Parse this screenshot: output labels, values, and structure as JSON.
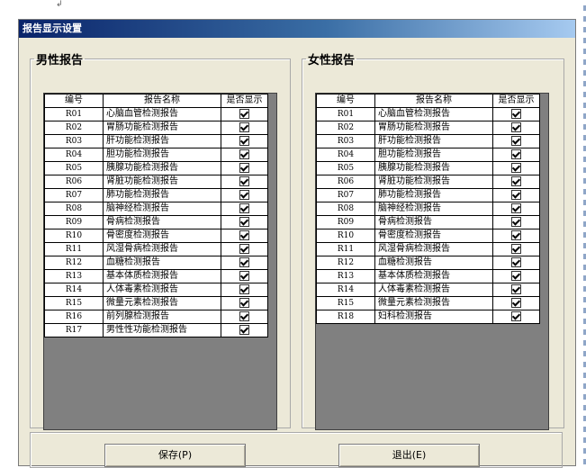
{
  "mark": "↲",
  "window": {
    "title": "报告显示设置"
  },
  "male": {
    "legend": "男性报告",
    "headers": {
      "id": "编号",
      "name": "报告名称",
      "show": "是否显示"
    },
    "rows": [
      {
        "id": "R01",
        "name": "心脑血管检测报告",
        "show": true
      },
      {
        "id": "R02",
        "name": "胃肠功能检测报告",
        "show": true
      },
      {
        "id": "R03",
        "name": "肝功能检测报告",
        "show": true
      },
      {
        "id": "R04",
        "name": "胆功能检测报告",
        "show": true
      },
      {
        "id": "R05",
        "name": "胰腺功能检测报告",
        "show": true
      },
      {
        "id": "R06",
        "name": "肾脏功能检测报告",
        "show": true
      },
      {
        "id": "R07",
        "name": "肺功能检测报告",
        "show": true
      },
      {
        "id": "R08",
        "name": "脑神经检测报告",
        "show": true
      },
      {
        "id": "R09",
        "name": "骨病检测报告",
        "show": true
      },
      {
        "id": "R10",
        "name": "骨密度检测报告",
        "show": true
      },
      {
        "id": "R11",
        "name": "风湿骨病检测报告",
        "show": true
      },
      {
        "id": "R12",
        "name": "血糖检测报告",
        "show": true
      },
      {
        "id": "R13",
        "name": "基本体质检测报告",
        "show": true
      },
      {
        "id": "R14",
        "name": "人体毒素检测报告",
        "show": true
      },
      {
        "id": "R15",
        "name": "微量元素检测报告",
        "show": true
      },
      {
        "id": "R16",
        "name": "前列腺检测报告",
        "show": true
      },
      {
        "id": "R17",
        "name": "男性性功能检测报告",
        "show": true
      }
    ]
  },
  "female": {
    "legend": "女性报告",
    "headers": {
      "id": "编号",
      "name": "报告名称",
      "show": "是否显示"
    },
    "rows": [
      {
        "id": "R01",
        "name": "心脑血管检测报告",
        "show": true
      },
      {
        "id": "R02",
        "name": "胃肠功能检测报告",
        "show": true
      },
      {
        "id": "R03",
        "name": "肝功能检测报告",
        "show": true
      },
      {
        "id": "R04",
        "name": "胆功能检测报告",
        "show": true
      },
      {
        "id": "R05",
        "name": "胰腺功能检测报告",
        "show": true
      },
      {
        "id": "R06",
        "name": "肾脏功能检测报告",
        "show": true
      },
      {
        "id": "R07",
        "name": "肺功能检测报告",
        "show": true
      },
      {
        "id": "R08",
        "name": "脑神经检测报告",
        "show": true
      },
      {
        "id": "R09",
        "name": "骨病检测报告",
        "show": true
      },
      {
        "id": "R10",
        "name": "骨密度检测报告",
        "show": true
      },
      {
        "id": "R11",
        "name": "风湿骨病检测报告",
        "show": true
      },
      {
        "id": "R12",
        "name": "血糖检测报告",
        "show": true
      },
      {
        "id": "R13",
        "name": "基本体质检测报告",
        "show": true
      },
      {
        "id": "R14",
        "name": "人体毒素检测报告",
        "show": true
      },
      {
        "id": "R15",
        "name": "微量元素检测报告",
        "show": true
      },
      {
        "id": "R18",
        "name": "妇科检测报告",
        "show": true
      }
    ]
  },
  "buttons": {
    "save": "保存(P)",
    "exit": "退出(E)"
  }
}
